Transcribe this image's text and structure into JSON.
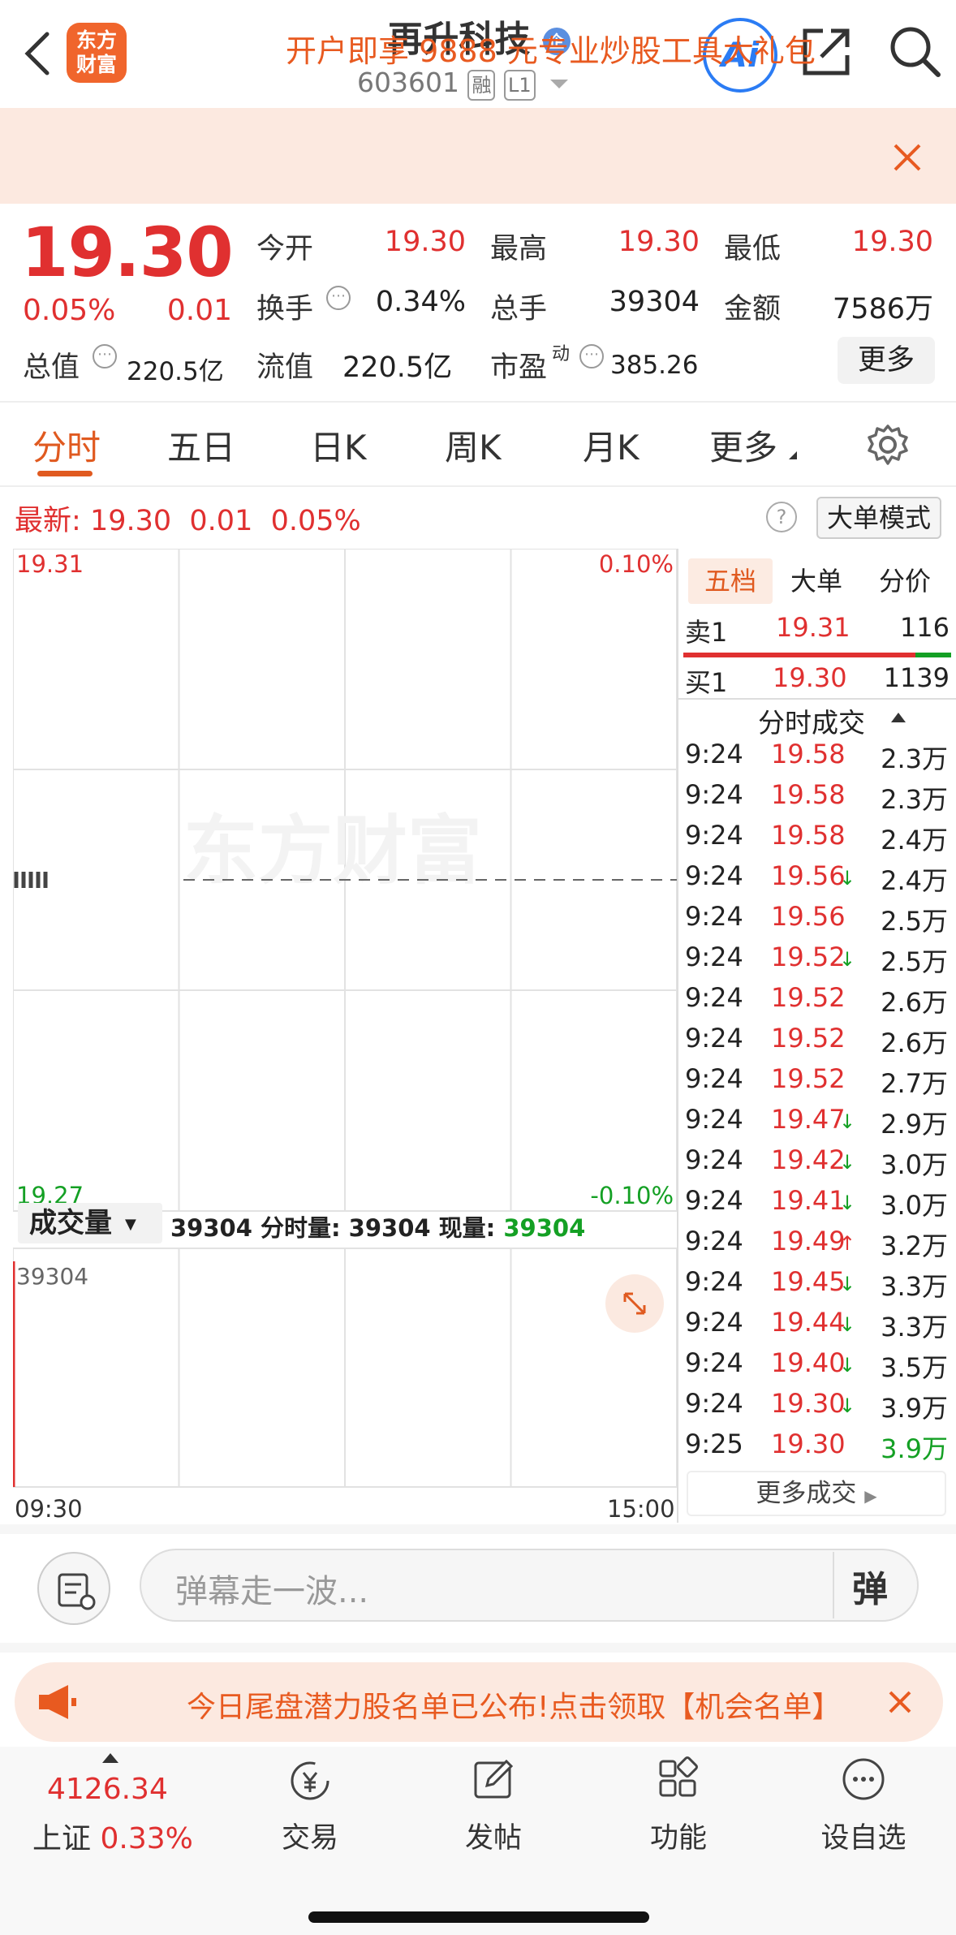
{
  "header": {
    "stock_name": "再升科技",
    "enterprise_badge": "企",
    "stock_code": "603601",
    "margin_tag": "融",
    "level_tag": "L1",
    "logo_text_line1": "东方",
    "logo_text_line2": "财富",
    "ai_label": "Ai"
  },
  "banner": {
    "text": "开户即享 9888 元专业炒股工具大礼包"
  },
  "quote": {
    "price": "19.30",
    "change_pct": "0.05%",
    "change_amt": "0.01",
    "open_label": "今开",
    "open": "19.30",
    "high_label": "最高",
    "high": "19.30",
    "low_label": "最低",
    "low": "19.30",
    "turnover_label": "换手",
    "turnover": "0.34%",
    "volume_label": "总手",
    "volume": "39304",
    "amount_label": "金额",
    "amount": "7586万",
    "mcap_label": "总值",
    "mcap": "220.5亿",
    "float_label": "流值",
    "float": "220.5亿",
    "pe_label": "市盈",
    "pe_sup": "动",
    "pe": "385.26",
    "more_label": "更多"
  },
  "tabs": [
    "分时",
    "五日",
    "日K",
    "周K",
    "月K",
    "更多"
  ],
  "latest": {
    "label": "最新:",
    "price": "19.30",
    "change": "0.01",
    "pct": "0.05%",
    "big_order_btn": "大单模式"
  },
  "chart": {
    "price_top": "19.31",
    "price_bottom": "19.27",
    "pct_top": "0.10%",
    "pct_bottom": "-0.10%",
    "watermark": "东方财富",
    "vol_selector": "成交量",
    "vol_info_prefix": "39304 分时量: 39304 现量: ",
    "vol_info_current": "39304",
    "vol_max": "39304",
    "time_start": "09:30",
    "time_end": "15:00"
  },
  "chart_data": {
    "type": "line",
    "x": [
      "09:30",
      "15:00"
    ],
    "ylim": [
      19.27,
      19.31
    ],
    "series": [
      {
        "values": [
          19.29
        ]
      }
    ],
    "volume": {
      "values": [
        39304
      ],
      "ylim": [
        0,
        39304
      ]
    }
  },
  "orderbook": {
    "tabs": [
      "五档",
      "大单",
      "分价"
    ],
    "sell1": {
      "label": "卖1",
      "price": "19.31",
      "qty": "116"
    },
    "buy1": {
      "label": "买1",
      "price": "19.30",
      "qty": "1139"
    },
    "ticks_header": "分时成交",
    "ticks": [
      {
        "time": "9:24",
        "price": "19.58",
        "arrow": "",
        "vol": "2.3万"
      },
      {
        "time": "9:24",
        "price": "19.58",
        "arrow": "",
        "vol": "2.3万"
      },
      {
        "time": "9:24",
        "price": "19.58",
        "arrow": "",
        "vol": "2.4万"
      },
      {
        "time": "9:24",
        "price": "19.56",
        "arrow": "↓",
        "vol": "2.4万"
      },
      {
        "time": "9:24",
        "price": "19.56",
        "arrow": "",
        "vol": "2.5万"
      },
      {
        "time": "9:24",
        "price": "19.52",
        "arrow": "↓",
        "vol": "2.5万"
      },
      {
        "time": "9:24",
        "price": "19.52",
        "arrow": "",
        "vol": "2.6万"
      },
      {
        "time": "9:24",
        "price": "19.52",
        "arrow": "",
        "vol": "2.6万"
      },
      {
        "time": "9:24",
        "price": "19.52",
        "arrow": "",
        "vol": "2.7万"
      },
      {
        "time": "9:24",
        "price": "19.47",
        "arrow": "↓",
        "vol": "2.9万"
      },
      {
        "time": "9:24",
        "price": "19.42",
        "arrow": "↓",
        "vol": "3.0万"
      },
      {
        "time": "9:24",
        "price": "19.41",
        "arrow": "↓",
        "vol": "3.0万"
      },
      {
        "time": "9:24",
        "price": "19.49",
        "arrow": "↑",
        "vol": "3.2万"
      },
      {
        "time": "9:24",
        "price": "19.45",
        "arrow": "↓",
        "vol": "3.3万"
      },
      {
        "time": "9:24",
        "price": "19.44",
        "arrow": "↓",
        "vol": "3.3万"
      },
      {
        "time": "9:24",
        "price": "19.40",
        "arrow": "↓",
        "vol": "3.5万"
      },
      {
        "time": "9:24",
        "price": "19.30",
        "arrow": "↓",
        "vol": "3.9万"
      },
      {
        "time": "9:25",
        "price": "19.30",
        "arrow": "",
        "vol": "3.9万"
      }
    ],
    "more_trades": "更多成交"
  },
  "comment": {
    "placeholder": "弹幕走一波...",
    "danmaku_btn": "弹"
  },
  "promo": {
    "text": "今日尾盘潜力股名单已公布!点击领取【机会名单】"
  },
  "bottom_nav": {
    "index_value": "4126.34",
    "index_name": "上证",
    "index_pct": "0.33%",
    "items": [
      "交易",
      "发帖",
      "功能",
      "设自选"
    ]
  },
  "colors": {
    "up": "#e03030",
    "down": "#14a024",
    "accent": "#e05a20"
  }
}
